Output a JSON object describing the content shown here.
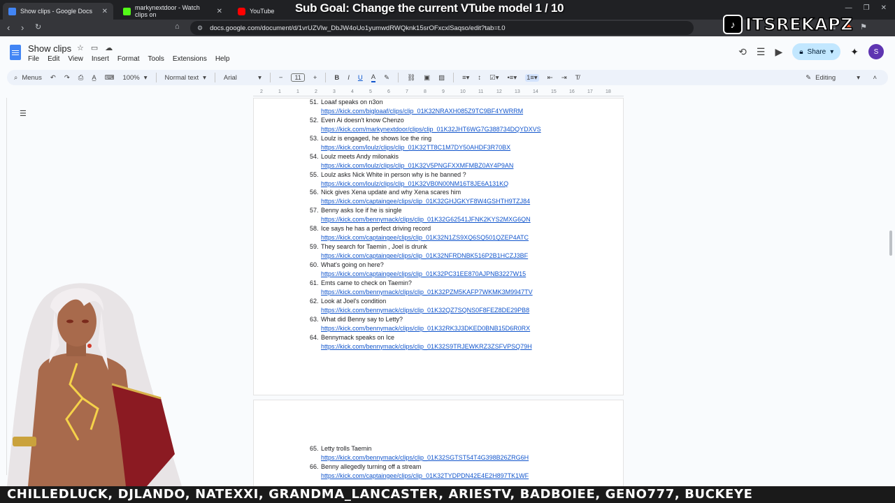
{
  "browser": {
    "tabs": [
      {
        "label": "Show clips - Google Docs",
        "icon": "google-docs-icon",
        "color": "#4285f4"
      },
      {
        "label": "markynextdoor - Watch clips on",
        "icon": "kick-icon",
        "color": "#53fc18"
      },
      {
        "label": "YouTube",
        "icon": "youtube-icon",
        "color": "#ff0000"
      }
    ],
    "url": "docs.google.com/document/d/1vrUZVlw_DbJW4oUo1yumwdRWQknk15srOFxcxlSaqso/edit?tab=t.0"
  },
  "docs": {
    "title": "Show clips",
    "menu": [
      "File",
      "Edit",
      "View",
      "Insert",
      "Format",
      "Tools",
      "Extensions",
      "Help"
    ],
    "share_label": "Share",
    "avatar_initial": "S",
    "toolbar": {
      "menus_label": "Menus",
      "zoom": "100%",
      "style": "Normal text",
      "font": "Arial",
      "font_size": "11",
      "mode": "Editing"
    },
    "ruler_marks": [
      "2",
      "1",
      "1",
      "2",
      "3",
      "4",
      "5",
      "6",
      "7",
      "8",
      "9",
      "10",
      "11",
      "12",
      "13",
      "14",
      "15",
      "16",
      "17",
      "18"
    ]
  },
  "entries_page1": [
    {
      "num": "51.",
      "title": "Loaaf speaks on n3on",
      "link": "https://kick.com/bigloaaf/clips/clip_01K32NRAXH085Z9TC9BF4YWRRM"
    },
    {
      "num": "52.",
      "title": "Even Ai doesn't know Chenzo",
      "link": "https://kick.com/markynextdoor/clips/clip_01K32JHT6WG7G388734DQYDXVS"
    },
    {
      "num": "53.",
      "title": "Loulz is engaged, he shows Ice the ring",
      "link": "https://kick.com/loulz/clips/clip_01K32TT8C1M7DY50AHDF3R70BX"
    },
    {
      "num": "54.",
      "title": "Loulz meets Andy milonakis",
      "link": "https://kick.com/loulz/clips/clip_01K32V5PNGFXXMFMBZ0AY4P9AN"
    },
    {
      "num": "55.",
      "title": "Loulz asks Nick White in person why is he banned ?",
      "link": "https://kick.com/loulz/clips/clip_01K32VB0N00NM16T8JE6A131KQ"
    },
    {
      "num": "56.",
      "title": "Nick gives Xena update and why Xena scares him",
      "link": "https://kick.com/captaingee/clips/clip_01K32GHJGKYF8W4GSHTH9TZJ84"
    },
    {
      "num": "57.",
      "title": "Benny asks Ice if he is single",
      "link": "https://kick.com/bennymack/clips/clip_01K32G62541JFNK2KYS2MXG6QN"
    },
    {
      "num": "58.",
      "title": "Ice says he has a perfect driving record",
      "link": "https://kick.com/captaingee/clips/clip_01K32N1ZS9XQ6SQ501QZEP4ATC"
    },
    {
      "num": "59.",
      "title": "They search for Taemin , Joel is drunk",
      "link": "https://kick.com/captaingee/clips/clip_01K32NFRDNBK516P2B1HCZJ3BF"
    },
    {
      "num": "60.",
      "title": "What's going on here?",
      "link": "https://kick.com/captaingee/clips/clip_01K32PC31EE870AJPNB3227W15"
    },
    {
      "num": "61.",
      "title": "Emts came to check on Taemin?",
      "link": "https://kick.com/bennymack/clips/clip_01K32PZM5KAFP7WKMK3M9947TV"
    },
    {
      "num": "62.",
      "title": "Look at Joel's condition",
      "link": "https://kick.com/bennymack/clips/clip_01K32QZ7SQNS0F8FEZ8DE29PB8"
    },
    {
      "num": "63.",
      "title": "What did Benny say to Letty?",
      "link": "https://kick.com/bennymack/clips/clip_01K32RK3J3DKED0BNB15D6R0RX"
    },
    {
      "num": "64.",
      "title": "Bennymack speaks on Ice",
      "link": "https://kick.com/bennymack/clips/clip_01K32S9TRJEWKRZ3ZSFVPSQ79H"
    }
  ],
  "entries_page2": [
    {
      "num": "65.",
      "title": "Letty trolls Taemin",
      "link": "https://kick.com/bennymack/clips/clip_01K32SGTST54T4G398B26ZRG6H"
    },
    {
      "num": "66.",
      "title": "Benny allegedly turning off a stream",
      "link": "https://kick.com/captaingee/clips/clip_01K32TYDPDN42E4E2H897TK1WF"
    }
  ],
  "overlay": {
    "sub_goal": "Sub Goal: Change the current VTube model  1 / 10",
    "badge_handle": "ITSREKAPZ",
    "ticker": "CHILLEDLUCK, DJLANDO, NATEXXI, GRANDMA_LANCASTER, ARIESTV, BADBOIEE, GENO777, BUCKEYE"
  },
  "colors": {
    "link": "#1155cc",
    "share_bg": "#c2e7ff",
    "accent": "#4285f4"
  }
}
